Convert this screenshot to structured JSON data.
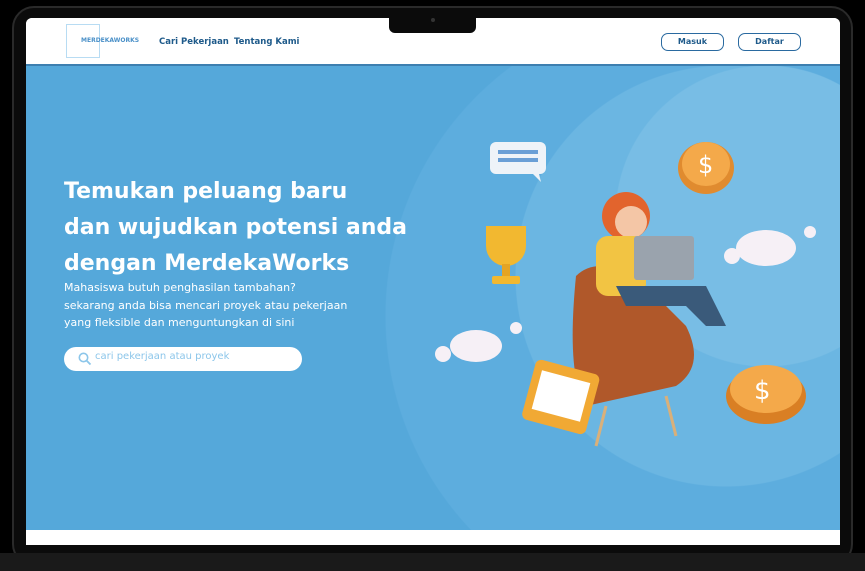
{
  "nav": {
    "logo_text": "MERDEKAWORKS",
    "links": [
      "Cari Pekerjaan",
      "Tentang Kami"
    ],
    "login_label": "Masuk",
    "register_label": "Daftar"
  },
  "hero": {
    "title_lines": [
      "Temukan peluang baru",
      "dan wujudkan potensi anda",
      "dengan MerdekaWorks"
    ],
    "subtitle_lines": [
      "Mahasiswa butuh penghasilan tambahan?",
      "sekarang anda bisa mencari proyek atau pekerjaan",
      "yang fleksible dan menguntungkan di sini"
    ],
    "search_placeholder": "cari pekerjaan atau proyek"
  },
  "colors": {
    "hero_bg": "#55a8da",
    "accent": "#1e5a8a"
  }
}
